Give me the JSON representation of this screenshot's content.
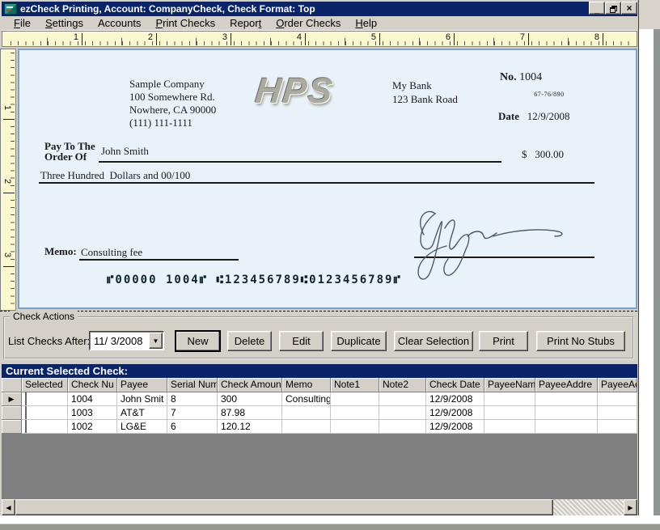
{
  "window": {
    "title": "ezCheck Printing, Account: CompanyCheck, Check Format: Top"
  },
  "icons": {
    "minimize": "_",
    "close": "×",
    "combo_arrow": "▼",
    "scroll_left": "◀",
    "scroll_right": "▶",
    "row_arrow": "▶"
  },
  "menu": {
    "items": [
      {
        "pre": "",
        "key": "F",
        "post": "ile"
      },
      {
        "pre": "",
        "key": "S",
        "post": "ettings"
      },
      {
        "pre": "Accounts",
        "key": "",
        "post": ""
      },
      {
        "pre": "",
        "key": "P",
        "post": "rint Checks"
      },
      {
        "pre": "Repor",
        "key": "t",
        "post": ""
      },
      {
        "pre": "",
        "key": "O",
        "post": "rder Checks"
      },
      {
        "pre": "",
        "key": "H",
        "post": "elp"
      }
    ]
  },
  "ruler": {
    "h_labels": [
      "1",
      "2",
      "3",
      "4",
      "5",
      "6",
      "7",
      "8"
    ],
    "v_labels": [
      "1",
      "2",
      "3"
    ]
  },
  "check": {
    "company_name": "Sample Company",
    "company_addr1": "100 Somewhere Rd.",
    "company_addr2": "Nowhere, CA 90000",
    "company_phone": "(111) 111-1111",
    "logo_text": "HPS",
    "bank_name": "My Bank",
    "bank_addr": "123 Bank Road",
    "no_label": "No.",
    "check_number": "1004",
    "fraction": "67-76/890",
    "date_label": "Date",
    "date_value": "12/9/2008",
    "pay_to_line1": "Pay To The",
    "pay_to_line2": "Order Of",
    "payee": "John Smith",
    "dollar_sign": "$",
    "amount": "300.00",
    "amount_words": "Three Hundred  Dollars and 00/100",
    "memo_label": "Memo:",
    "memo_value": "Consulting fee",
    "micr": "⑈00000 1004⑈ ⑆123456789⑆0123456789⑈"
  },
  "check_actions": {
    "group_label": "Check Actions",
    "list_after_label": "List Checks After:",
    "date_filter_value": "11/ 3/2008",
    "buttons": [
      "New",
      "Delete",
      "Edit",
      "Duplicate",
      "Clear Selection",
      "Print",
      "Print No Stubs"
    ]
  },
  "selected_check": {
    "title": "Current Selected Check:",
    "columns": [
      "Selected",
      "Check Nu",
      "Payee",
      "Serial Num",
      "Check Amount",
      "Memo",
      "Note1",
      "Note2",
      "Check Date",
      "PayeeName",
      "PayeeAddre",
      "PayeeAc"
    ],
    "rows": [
      {
        "check_num": "1004",
        "payee": "John Smit",
        "serial": "8",
        "amount": "300",
        "memo": "Consulting",
        "note1": "",
        "note2": "",
        "date": "12/9/2008",
        "payee_name": "",
        "payee_addr": "",
        "payee_ac": ""
      },
      {
        "check_num": "1003",
        "payee": "AT&T",
        "serial": "7",
        "amount": "87.98",
        "memo": "",
        "note1": "",
        "note2": "",
        "date": "12/9/2008",
        "payee_name": "",
        "payee_addr": "",
        "payee_ac": ""
      },
      {
        "check_num": "1002",
        "payee": "LG&E",
        "serial": "6",
        "amount": "120.12",
        "memo": "",
        "note1": "",
        "note2": "",
        "date": "12/9/2008",
        "payee_name": "",
        "payee_addr": "",
        "payee_ac": ""
      }
    ]
  },
  "colors": {
    "titlebar": "#0a246a",
    "face": "#d4d0c8",
    "ruler_bg": "#fbf8d0",
    "check_bg": "#e9f2f9",
    "check_border": "#7aa2d4",
    "section_header_bg": "#0a246a",
    "empty_area": "#808080"
  }
}
